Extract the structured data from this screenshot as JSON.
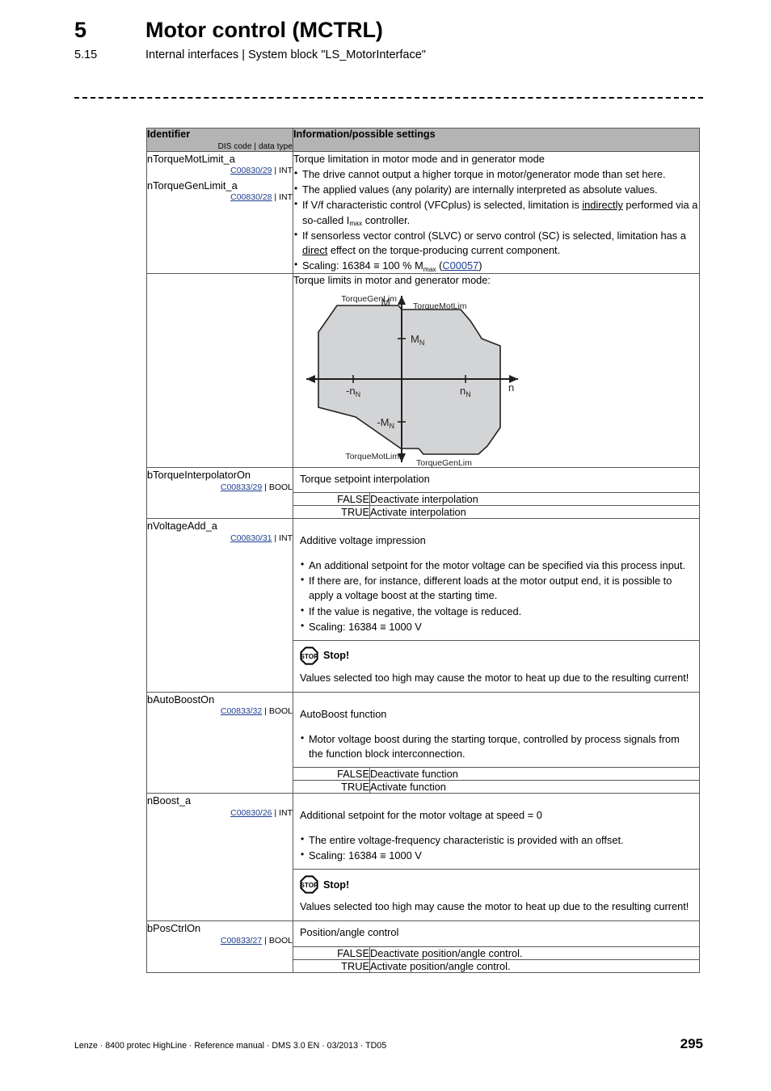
{
  "header": {
    "chapter_number": "5",
    "chapter_title": "Motor control (MCTRL)",
    "section_number": "5.15",
    "section_title": "Internal interfaces | System block \"LS_MotorInterface\""
  },
  "table": {
    "head_identifier": "Identifier",
    "head_identifier_sub": "DIS code | data type",
    "head_info": "Information/possible settings"
  },
  "rows": {
    "torque_limit": {
      "id1": "nTorqueMotLimit_a",
      "code1": "C00830/29",
      "type1": "INT",
      "id2": "nTorqueGenLimit_a",
      "code2": "C00830/28",
      "type2": "INT",
      "title": "Torque limitation in motor mode and in generator mode",
      "b1": "The drive cannot output a higher torque in motor/generator mode than set here.",
      "b2": "The applied values (any polarity) are internally interpreted as absolute values.",
      "b3_a": "If V/f characteristic control (VFCplus) is selected, limitation is ",
      "b3_u": "indirectly",
      "b3_b": " performed via a so-called I",
      "b3_sub": "max",
      "b3_c": " controller.",
      "b4_a": "If sensorless vector control (SLVC) or servo control (SC) is selected, limitation has a ",
      "b4_u": "direct",
      "b4_b": " effect on the torque-producing current component.",
      "b5_a": "Scaling: 16384 ",
      "b5_eq": "≡",
      "b5_b": " 100 % M",
      "b5_sub": "max",
      "b5_c": " (",
      "b5_link": "C00057",
      "b5_d": ")"
    },
    "diagram": {
      "caption": "Torque limits in motor and generator mode:",
      "label_axis_m": "M",
      "label_axis_n": "n",
      "label_mn_pos": "M",
      "label_mn_pos_sub": "N",
      "label_mn_neg": "-M",
      "label_mn_neg_sub": "N",
      "label_nn_pos": "n",
      "label_nn_pos_sub": "N",
      "label_nn_neg": "-n",
      "label_nn_neg_sub": "N",
      "label_gen_top": "TorqueGenLim",
      "label_mot_top": "TorqueMotLim",
      "label_mot_bottom": "TorqueMotLim",
      "label_gen_bottom": "TorqueGenLim",
      "fill_color": "#d3d4d6",
      "stroke_color": "#231f20"
    },
    "torque_interp": {
      "id": "bTorqueInterpolatorOn",
      "code": "C00833/29",
      "type": "BOOL",
      "title": "Torque setpoint interpolation",
      "options": [
        {
          "key": "FALSE",
          "val": "Deactivate interpolation"
        },
        {
          "key": "TRUE",
          "val": "Activate interpolation"
        }
      ]
    },
    "voltage_add": {
      "id": "nVoltageAdd_a",
      "code": "C00830/31",
      "type": "INT",
      "title": "Additive voltage impression",
      "b1": "An additional setpoint for the motor voltage can be specified via this process input.",
      "b2": "If there are, for instance, different loads at the motor output end, it is possible to apply a voltage boost at the starting time.",
      "b3": "If the value is negative, the voltage is reduced.",
      "b4_a": "Scaling: 16384 ",
      "b4_eq": "≡",
      "b4_b": " 1000 V",
      "stop_icon": "stop-octagon-icon",
      "stop_title": "Stop!",
      "stop_text": "Values selected too high may cause the motor to heat up due to the resulting current!"
    },
    "autoboost": {
      "id": "bAutoBoostOn",
      "code": "C00833/32",
      "type": "BOOL",
      "title": "AutoBoost function",
      "b1": "Motor voltage boost during the starting torque, controlled by process signals from the function block interconnection.",
      "options": [
        {
          "key": "FALSE",
          "val": "Deactivate function"
        },
        {
          "key": "TRUE",
          "val": "Activate function"
        }
      ]
    },
    "boost": {
      "id": "nBoost_a",
      "code": "C00830/26",
      "type": "INT",
      "title": "Additional setpoint for the motor voltage at speed = 0",
      "b1": "The entire voltage-frequency characteristic is provided with an offset.",
      "b2_a": "Scaling: 16384 ",
      "b2_eq": "≡",
      "b2_b": " 1000 V",
      "stop_icon": "stop-octagon-icon",
      "stop_title": "Stop!",
      "stop_text": "Values selected too high may cause the motor to heat up due to the resulting current!"
    },
    "posctrl": {
      "id": "bPosCtrlOn",
      "code": "C00833/27",
      "type": "BOOL",
      "title": "Position/angle control",
      "options": [
        {
          "key": "FALSE",
          "val": "Deactivate position/angle control."
        },
        {
          "key": "TRUE",
          "val": "Activate position/angle control."
        }
      ]
    }
  },
  "footer": {
    "left": "Lenze · 8400 protec HighLine · Reference manual · DMS 3.0 EN · 03/2013 · TD05",
    "page": "295"
  },
  "colors": {
    "link": "#1d3f8f",
    "table_header_bg": "#b4b4b4",
    "border": "#58585a"
  }
}
